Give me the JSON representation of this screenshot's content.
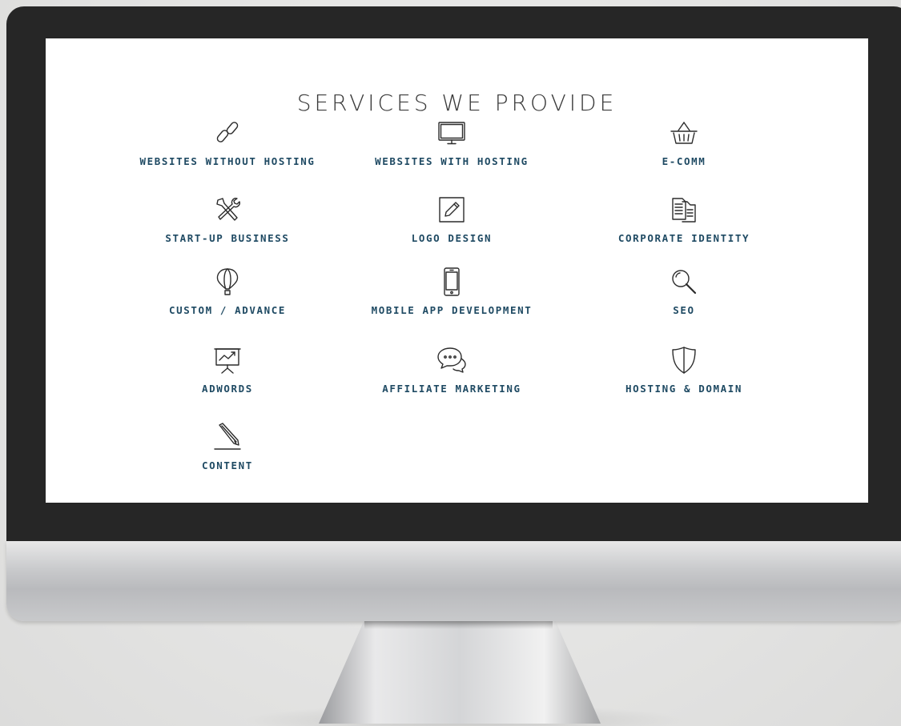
{
  "page": {
    "title": "SERVICES WE PROVIDE",
    "label_color": "#1f4a63",
    "title_color": "#3a3a3a"
  },
  "services": [
    {
      "label": "WEBSITES WITHOUT HOSTING",
      "icon": "link-icon"
    },
    {
      "label": "WEBSITES WITH HOSTING",
      "icon": "monitor-icon"
    },
    {
      "label": "E-COMM",
      "icon": "basket-icon"
    },
    {
      "label": "START-UP BUSINESS",
      "icon": "tools-icon"
    },
    {
      "label": "LOGO DESIGN",
      "icon": "pencil-box-icon"
    },
    {
      "label": "CORPORATE IDENTITY",
      "icon": "documents-icon"
    },
    {
      "label": "CUSTOM / ADVANCE",
      "icon": "balloon-icon"
    },
    {
      "label": "MOBILE APP DEVELOPMENT",
      "icon": "smartphone-icon"
    },
    {
      "label": "SEO",
      "icon": "magnifier-icon"
    },
    {
      "label": "ADWORDS",
      "icon": "presentation-chart-icon"
    },
    {
      "label": "AFFILIATE MARKETING",
      "icon": "chat-bubbles-icon"
    },
    {
      "label": "HOSTING & DOMAIN",
      "icon": "shield-icon"
    },
    {
      "label": "CONTENT",
      "icon": "pencil-icon"
    }
  ]
}
